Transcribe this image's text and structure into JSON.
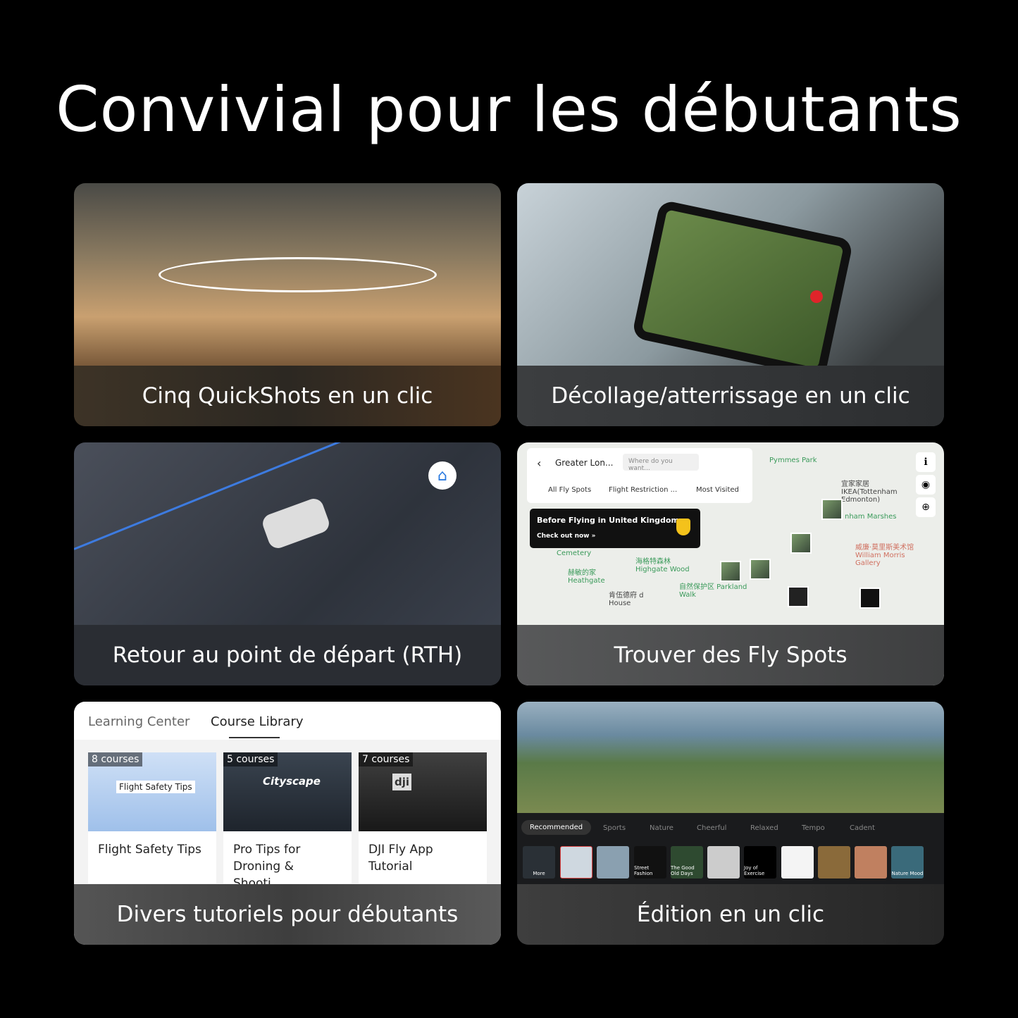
{
  "title": "Convivial pour les débutants",
  "cards": [
    {
      "caption": "Cinq QuickShots en un clic"
    },
    {
      "caption": "Décollage/atterrissage en un clic"
    },
    {
      "caption": "Retour au point de départ (RTH)"
    },
    {
      "caption": "Trouver des Fly Spots",
      "map": {
        "location": "Greater Lon...",
        "search_placeholder": "Where do you want...",
        "filters": [
          "All Fly Spots",
          "Flight Restriction ...",
          "Most Visited"
        ],
        "banner_title": "Before Flying in United Kingdom",
        "banner_action": "Check out now »",
        "labels": [
          "Pymmes Park",
          "宜家家居 IKEA(Tottenham Edmonton)",
          "nham Marshes",
          "威廉·莫里斯美术馆 William Morris Gallery",
          "Cemetery",
          "海格特森林 Highgate Wood",
          "赫敏的家 Heathgate",
          "自然保护区 Parkland Walk",
          "肯伍德府 d House"
        ]
      }
    },
    {
      "caption": "Divers tutoriels pour débutants",
      "tabs": [
        "Learning Center",
        "Course Library"
      ],
      "courses": [
        {
          "count": "8 courses",
          "name": "Flight Safety Tips",
          "thumb_text": "Flight Safety Tips"
        },
        {
          "count": "5 courses",
          "name": "Pro Tips for Droning & Shooti...",
          "thumb_text": "Cityscape"
        },
        {
          "count": "7 courses",
          "name": "DJI Fly App Tutorial",
          "thumb_text": "dji"
        }
      ]
    },
    {
      "caption": "Édition en un clic",
      "music_tabs": [
        "Recommended",
        "Sports",
        "Nature",
        "Cheerful",
        "Relaxed",
        "Tempo",
        "Cadent"
      ],
      "templates": [
        "More",
        "",
        "",
        "Street Fashion",
        "The Good Old Days",
        "",
        "Joy of Exercise",
        "",
        "",
        "",
        "",
        "Nature Mood"
      ]
    }
  ]
}
